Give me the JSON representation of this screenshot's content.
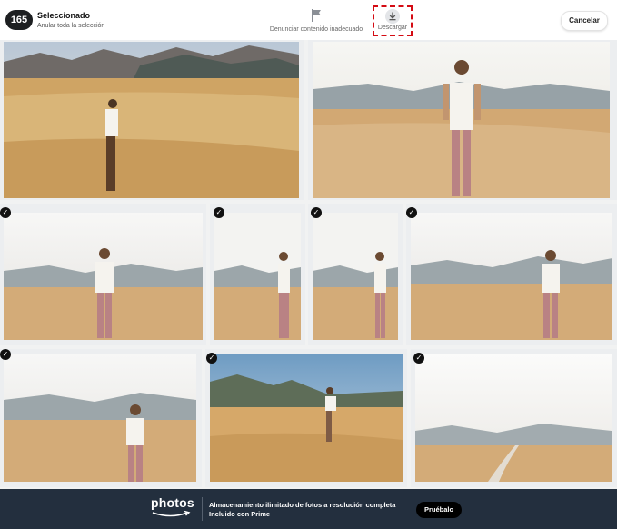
{
  "selection": {
    "count": "165",
    "title": "Seleccionado",
    "deselect_all": "Anular toda la selección"
  },
  "actions": {
    "report_label": "Denunciar contenido inadecuado",
    "report_icon": "flag-icon",
    "download_label": "Descargar",
    "download_icon": "download-icon",
    "download_highlight_color": "#d40b13"
  },
  "cancel_label": "Cancelar",
  "photos": [
    {
      "id": "photo-1",
      "selected": false
    },
    {
      "id": "photo-2",
      "selected": false
    },
    {
      "id": "photo-3",
      "selected": true
    },
    {
      "id": "photo-4",
      "selected": true
    },
    {
      "id": "photo-5",
      "selected": true
    },
    {
      "id": "photo-6",
      "selected": true
    },
    {
      "id": "photo-7",
      "selected": true
    },
    {
      "id": "photo-8",
      "selected": true
    },
    {
      "id": "photo-9",
      "selected": true
    }
  ],
  "banner": {
    "brand": "photos",
    "line1": "Almacenamiento ilimitado de fotos a resolución completa",
    "line2": "Incluido con Prime",
    "cta": "Pruébalo",
    "background": "#232f3e"
  }
}
